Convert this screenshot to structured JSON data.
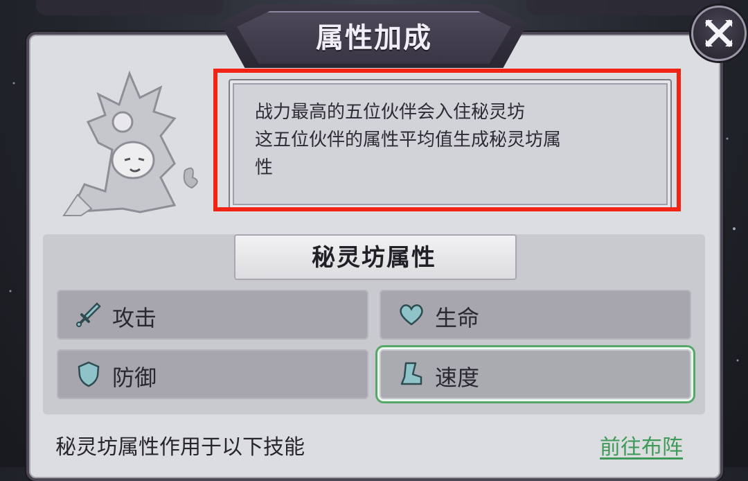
{
  "dialog": {
    "title": "属性加成",
    "close_icon": "close-icon"
  },
  "description": {
    "lines": [
      "战力最高的五位伙伴会入住秘灵坊",
      "这五位伙伴的属性平均值生成秘灵坊属",
      "性"
    ]
  },
  "stats_section": {
    "title": "秘灵坊属性",
    "items": [
      {
        "label": "攻击",
        "icon": "sword-icon",
        "selected": false
      },
      {
        "label": "生命",
        "icon": "heart-icon",
        "selected": false
      },
      {
        "label": "防御",
        "icon": "shield-icon",
        "selected": false
      },
      {
        "label": "速度",
        "icon": "boot-icon",
        "selected": true
      }
    ]
  },
  "footer": {
    "label": "秘灵坊属性作用于以下技能",
    "link": "前往布阵"
  },
  "colors": {
    "highlight": "#f02314",
    "link": "#3f9a58",
    "selected_border": "#56a86a",
    "icon_fill": "#8ec3c9"
  }
}
